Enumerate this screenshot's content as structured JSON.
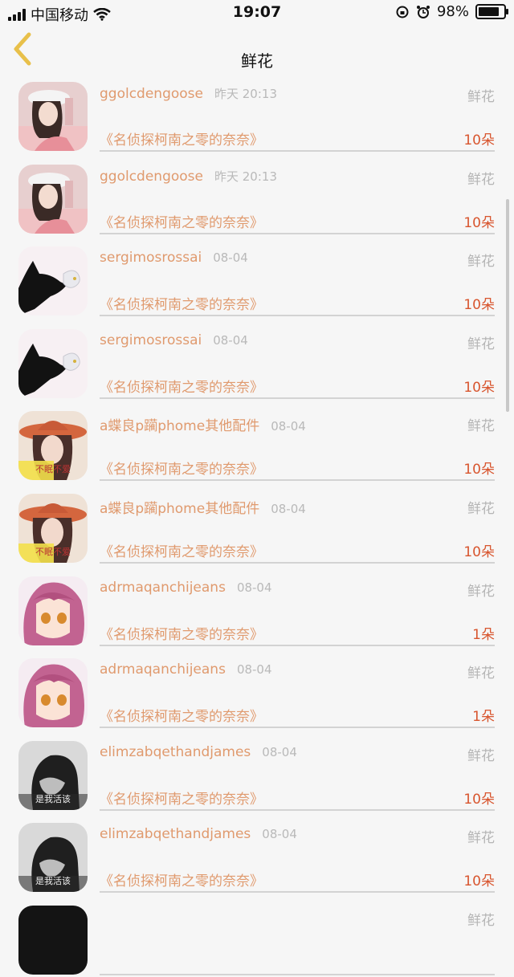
{
  "status_bar": {
    "carrier": "中国移动",
    "time": "19:07",
    "battery": "98%",
    "battery_level": 0.98
  },
  "nav": {
    "title": "鲜花"
  },
  "items": [
    {
      "name": "ggolcdengoose",
      "time": "昨天 20:13",
      "gift": "鲜花",
      "work": "《名侦探柯南之零的奈奈》",
      "count": "10朵",
      "avatar": "girl-white-hat"
    },
    {
      "name": "ggolcdengoose",
      "time": "昨天 20:13",
      "gift": "鲜花",
      "work": "《名侦探柯南之零的奈奈》",
      "count": "10朵",
      "avatar": "girl-white-hat"
    },
    {
      "name": "sergimosrossai",
      "time": "08-04",
      "gift": "鲜花",
      "work": "《名侦探柯南之零的奈奈》",
      "count": "10朵",
      "avatar": "black-cat"
    },
    {
      "name": "sergimosrossai",
      "time": "08-04",
      "gift": "鲜花",
      "work": "《名侦探柯南之零的奈奈》",
      "count": "10朵",
      "avatar": "black-cat"
    },
    {
      "name": "a蝶良p躏phome其他配件",
      "time": "08-04",
      "gift": "鲜花",
      "work": "《名侦探柯南之零的奈奈》",
      "count": "10朵",
      "avatar": "girl-red-hat",
      "avatar_text": "不眠不爱"
    },
    {
      "name": "a蝶良p躏phome其他配件",
      "time": "08-04",
      "gift": "鲜花",
      "work": "《名侦探柯南之零的奈奈》",
      "count": "10朵",
      "avatar": "girl-red-hat",
      "avatar_text": "不眠不爱"
    },
    {
      "name": "adrmaqanchijeans",
      "time": "08-04",
      "gift": "鲜花",
      "work": "《名侦探柯南之零的奈奈》",
      "count": "1朵",
      "avatar": "anime-girl"
    },
    {
      "name": "adrmaqanchijeans",
      "time": "08-04",
      "gift": "鲜花",
      "work": "《名侦探柯南之零的奈奈》",
      "count": "1朵",
      "avatar": "anime-girl"
    },
    {
      "name": "elimzabqethandjames",
      "time": "08-04",
      "gift": "鲜花",
      "work": "《名侦探柯南之零的奈奈》",
      "count": "10朵",
      "avatar": "bw-portrait",
      "avatar_text": "是我活该"
    },
    {
      "name": "elimzabqethandjames",
      "time": "08-04",
      "gift": "鲜花",
      "work": "《名侦探柯南之零的奈奈》",
      "count": "10朵",
      "avatar": "bw-portrait",
      "avatar_text": "是我活该"
    },
    {
      "name": "",
      "time": "",
      "gift": "鲜花",
      "work": "",
      "count": "",
      "avatar": "dark"
    }
  ],
  "colors": {
    "name": "#e09a6e",
    "count": "#d8552e",
    "back_arrow": "#e8c04a"
  }
}
